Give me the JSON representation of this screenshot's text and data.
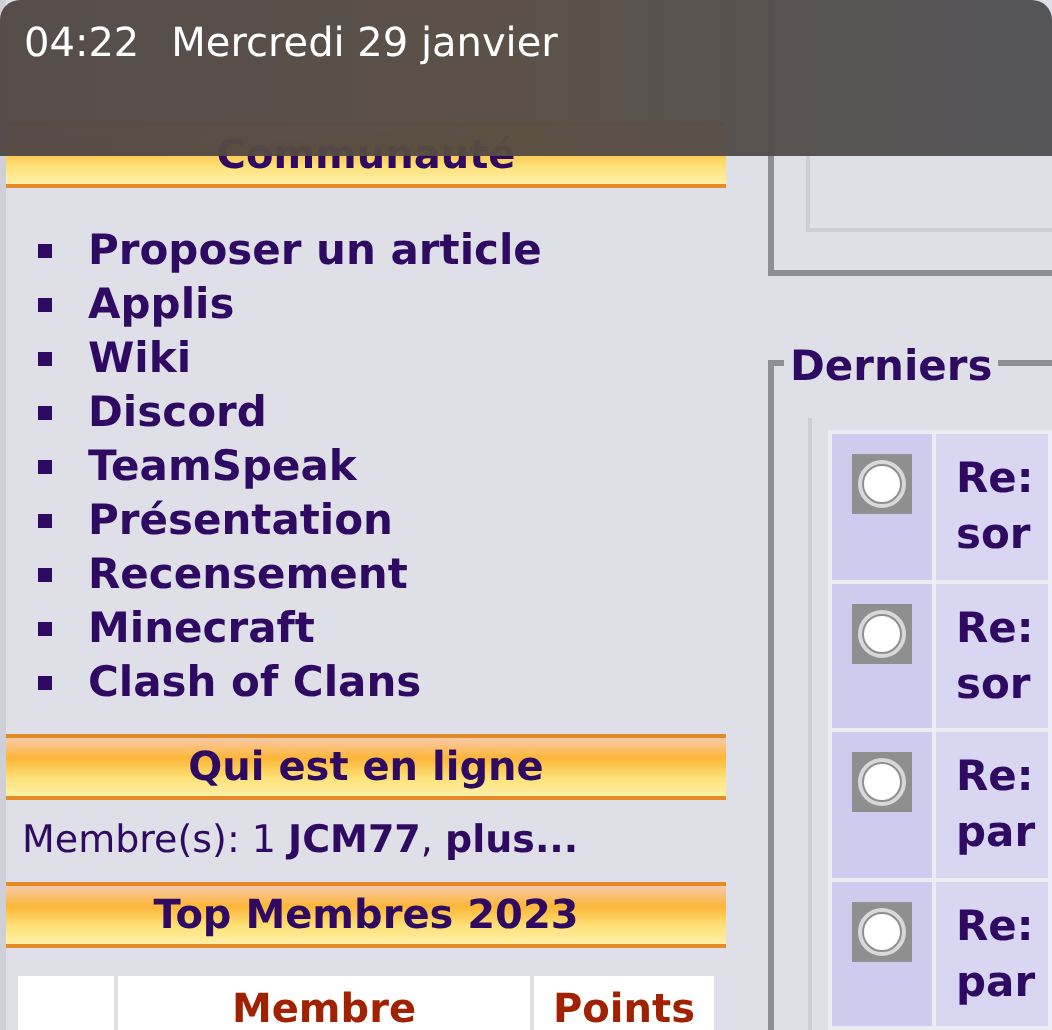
{
  "status_bar": {
    "time": "04:22",
    "date": "Mercredi 29 janvier"
  },
  "sidebar": {
    "community": {
      "title": "Communauté",
      "links": [
        "Proposer un article",
        "Applis",
        "Wiki",
        "Discord",
        "TeamSpeak",
        "Présentation",
        "Recensement",
        "Minecraft",
        "Clash of Clans"
      ]
    },
    "online": {
      "title": "Qui est en ligne",
      "text": "Membre(s): 1 **JCM77**, **plus...**"
    },
    "top_members": {
      "title": "Top Membres 2023",
      "columns": [
        "Membre",
        "Points"
      ]
    }
  },
  "latest": {
    "legend": "Derniers",
    "rows": [
      {
        "title": "Re: sor"
      },
      {
        "title": "Re: sor"
      },
      {
        "title": "Re: par"
      },
      {
        "title": "Re: par"
      }
    ]
  }
}
